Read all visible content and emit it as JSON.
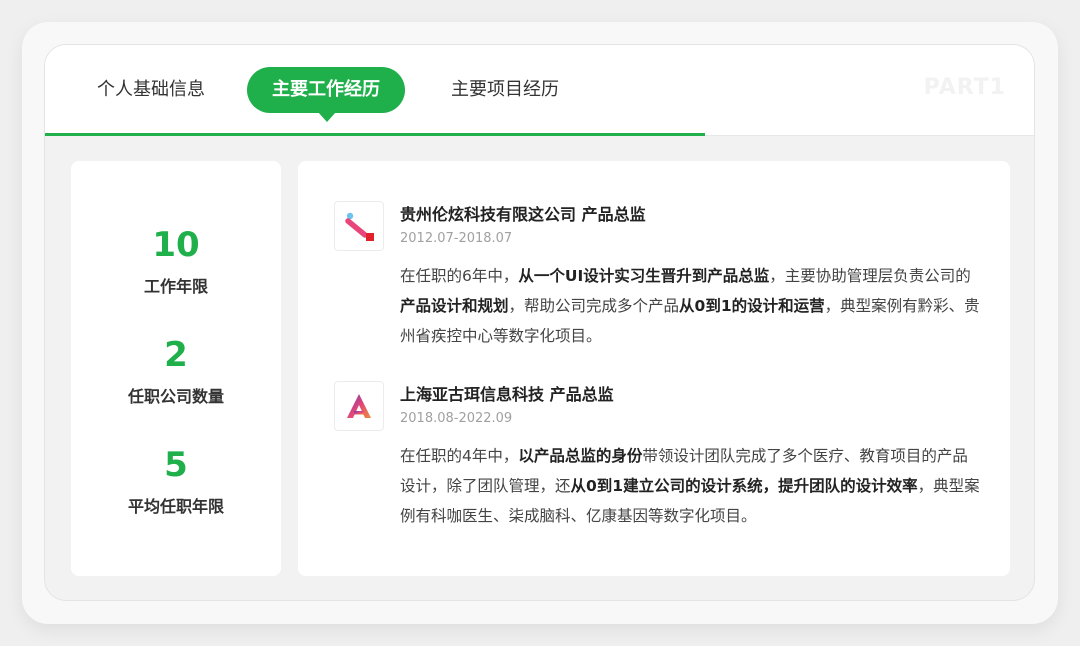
{
  "tabs": {
    "basic_info": "个人基础信息",
    "work_experience": "主要工作经历",
    "projects": "主要项目经历",
    "part_label": "PART1"
  },
  "stats": [
    {
      "value": "10",
      "label": "工作年限"
    },
    {
      "value": "2",
      "label": "任职公司数量"
    },
    {
      "value": "5",
      "label": "平均任职年限"
    }
  ],
  "experiences": [
    {
      "title": "贵州伦炫科技有限这公司 产品总监",
      "date": "2012.07-2018.07",
      "desc": [
        {
          "text": "在任职的6年中，",
          "bold": false
        },
        {
          "text": "从一个UI设计实习生晋升到产品总监",
          "bold": true
        },
        {
          "text": "，主要协助管理层负责公司的",
          "bold": false
        },
        {
          "text": "产品设计和规划",
          "bold": true
        },
        {
          "text": "，帮助公司完成多个产品",
          "bold": false
        },
        {
          "text": "从0到1的设计和运营",
          "bold": true
        },
        {
          "text": "，典型案例有黔彩、贵州省疾控中心等数字化项目。",
          "bold": false
        }
      ]
    },
    {
      "title": "上海亚古珥信息科技 产品总监",
      "date": "2018.08-2022.09",
      "desc": [
        {
          "text": "在任职的4年中，",
          "bold": false
        },
        {
          "text": "以产品总监的身份",
          "bold": true
        },
        {
          "text": "带领设计团队完成了多个医疗、教育项目的产品设计，除了团队管理，还",
          "bold": false
        },
        {
          "text": "从0到1建立公司的设计系统，提升团队的设计效率",
          "bold": true
        },
        {
          "text": "，典型案例有科咖医生、柒成脑科、亿康基因等数字化项目。",
          "bold": false
        }
      ]
    }
  ],
  "colors": {
    "accent": "#1faf4b",
    "logo1_pink": "#e8457a",
    "logo1_blue": "#6cc3f0",
    "logo1_red": "#e0202a"
  }
}
